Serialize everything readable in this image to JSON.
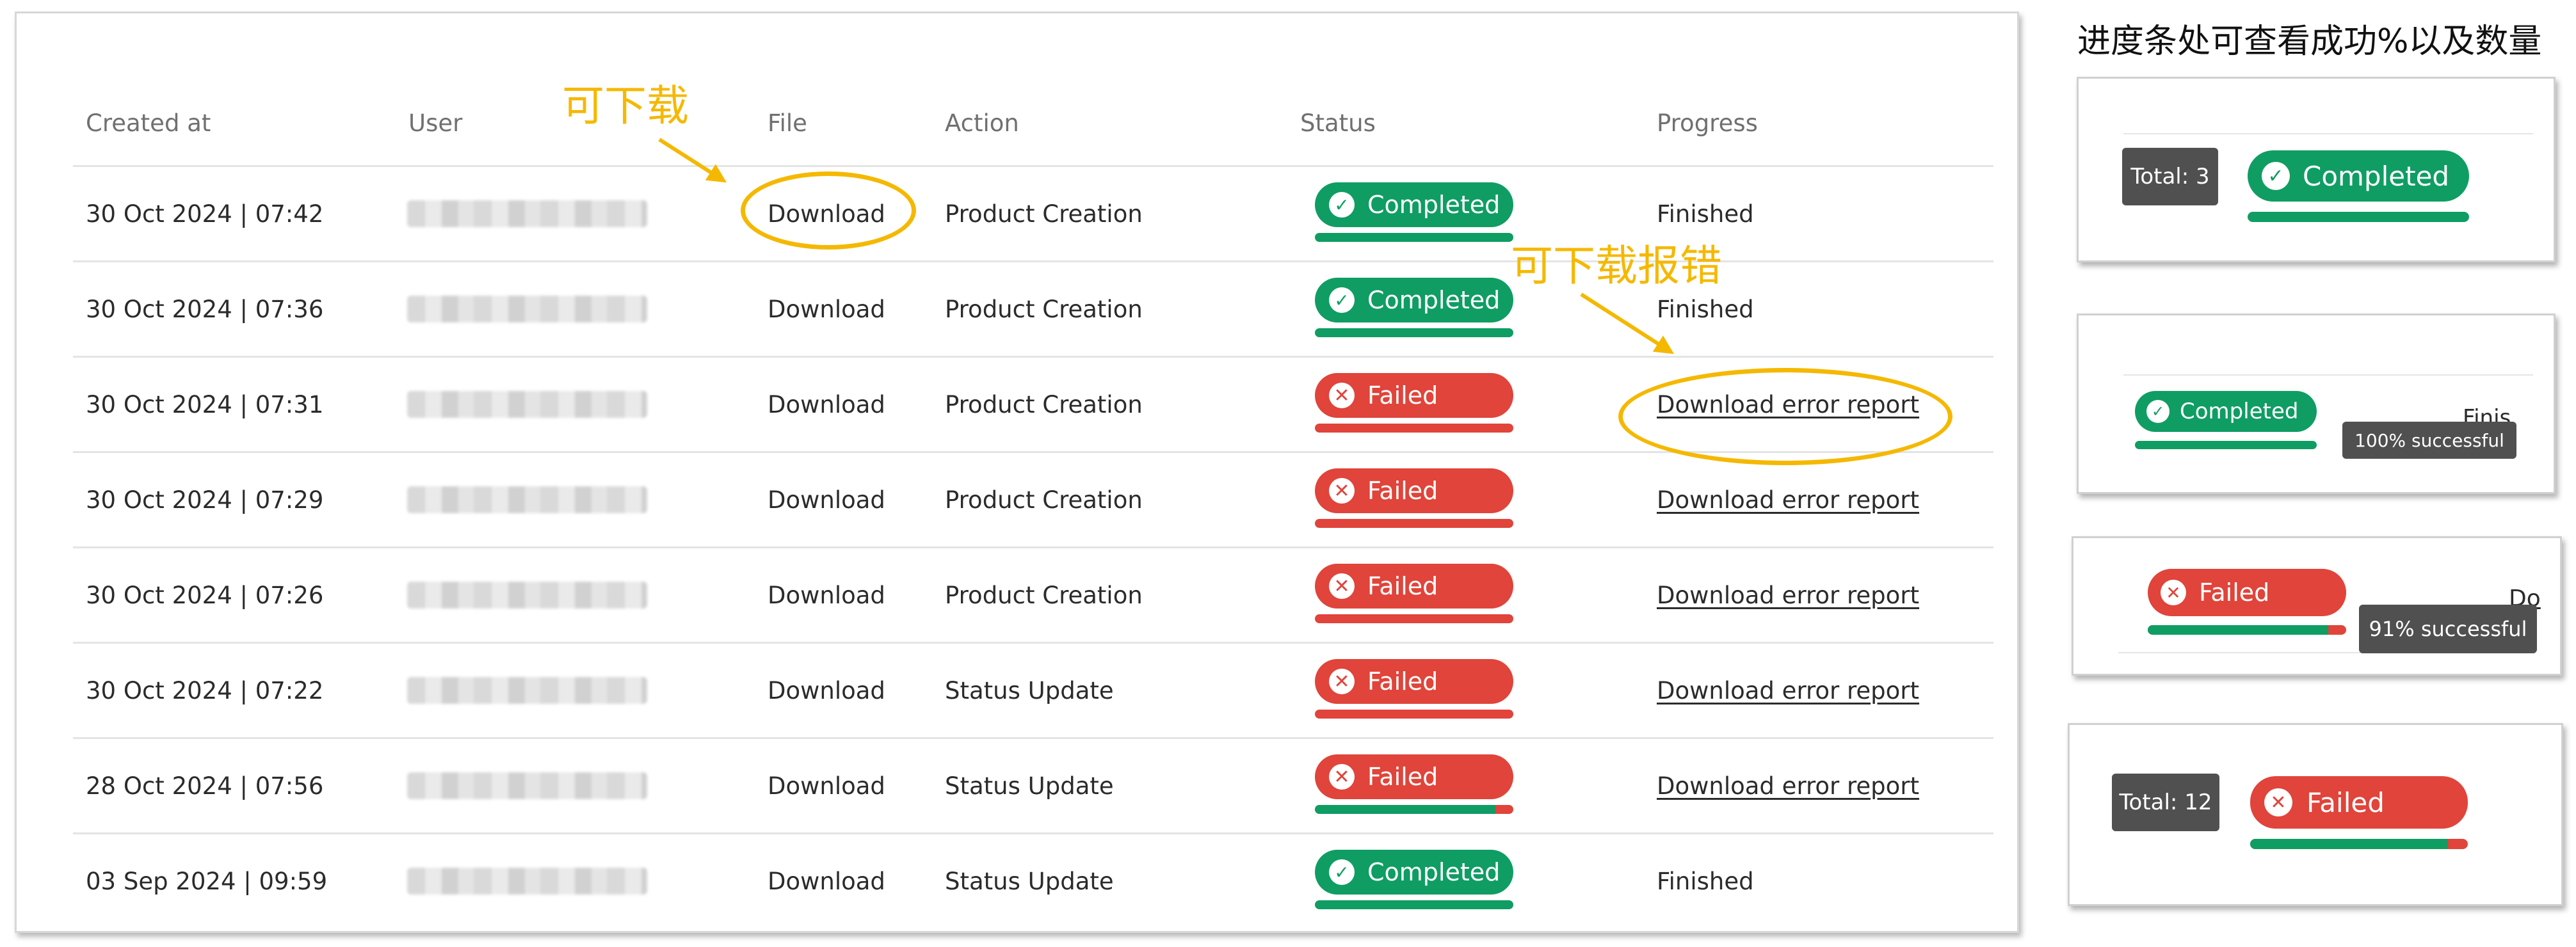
{
  "table": {
    "headers": {
      "created_at": "Created at",
      "user": "User",
      "file": "File",
      "action": "Action",
      "status": "Status",
      "progress": "Progress"
    },
    "rows": [
      {
        "created_at": "30 Oct 2024 | 07:42",
        "file": "Download",
        "action": "Product Creation",
        "status": "Completed",
        "status_kind": "ok",
        "success_fraction": 1.0,
        "progress": "Finished",
        "progress_is_link": false
      },
      {
        "created_at": "30 Oct 2024 | 07:36",
        "file": "Download",
        "action": "Product Creation",
        "status": "Completed",
        "status_kind": "ok",
        "success_fraction": 1.0,
        "progress": "Finished",
        "progress_is_link": false
      },
      {
        "created_at": "30 Oct 2024 | 07:31",
        "file": "Download",
        "action": "Product Creation",
        "status": "Failed",
        "status_kind": "bad",
        "success_fraction": 0.0,
        "progress": "Download error report",
        "progress_is_link": true
      },
      {
        "created_at": "30 Oct 2024 | 07:29",
        "file": "Download",
        "action": "Product Creation",
        "status": "Failed",
        "status_kind": "bad",
        "success_fraction": 0.0,
        "progress": "Download error report",
        "progress_is_link": true
      },
      {
        "created_at": "30 Oct 2024 | 07:26",
        "file": "Download",
        "action": "Product Creation",
        "status": "Failed",
        "status_kind": "bad",
        "success_fraction": 0.0,
        "progress": "Download error report",
        "progress_is_link": true
      },
      {
        "created_at": "30 Oct 2024 | 07:22",
        "file": "Download",
        "action": "Status Update",
        "status": "Failed",
        "status_kind": "bad",
        "success_fraction": 0.0,
        "progress": "Download error report",
        "progress_is_link": true
      },
      {
        "created_at": "28 Oct 2024 | 07:56",
        "file": "Download",
        "action": "Status Update",
        "status": "Failed",
        "status_kind": "bad",
        "success_fraction": 0.91,
        "progress": "Download error report",
        "progress_is_link": true
      },
      {
        "created_at": "03 Sep 2024 | 09:59",
        "file": "Download",
        "action": "Status Update",
        "status": "Completed",
        "status_kind": "ok",
        "success_fraction": 1.0,
        "progress": "Finished",
        "progress_is_link": false
      }
    ]
  },
  "annotations": {
    "downloadable": "可下载",
    "downloadable_error": "可下载报错",
    "note_title": "进度条处可查看成功%以及数量"
  },
  "cards": {
    "card1": {
      "tooltip": "Total: 3",
      "status": "Completed",
      "success_fraction": 1.0
    },
    "card2": {
      "status": "Completed",
      "tooltip": "100% successful",
      "partial_text": "Finis",
      "success_fraction": 1.0
    },
    "card3": {
      "status": "Failed",
      "tooltip": "91% successful",
      "partial_text": "Do",
      "success_fraction": 0.91
    },
    "card4": {
      "tooltip": "Total: 12",
      "status": "Failed",
      "success_fraction": 0.91
    }
  },
  "icons": {
    "completed": "check-circle-icon",
    "failed": "x-circle-icon"
  },
  "colors": {
    "success": "#0f9d63",
    "failure": "#e0443a",
    "annotation": "#f5b800",
    "tooltip": "#505050"
  }
}
